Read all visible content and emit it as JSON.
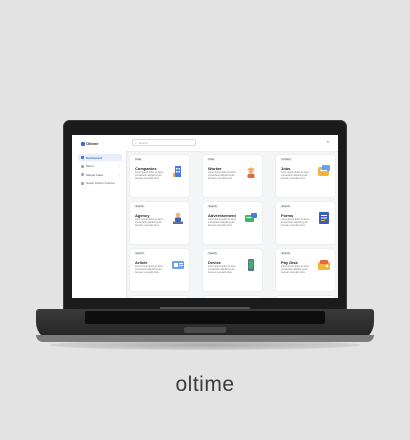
{
  "brand": "oltime",
  "app": {
    "logo_text": "Oltime",
    "search_placeholder": "Search",
    "close_symbol": "×"
  },
  "sidebar": {
    "items": [
      {
        "label": "Dashboard",
        "active": true
      },
      {
        "label": "Menu",
        "active": false
      },
      {
        "label": "Master Data",
        "active": false
      },
      {
        "label": "Super Admin Control",
        "active": false
      }
    ]
  },
  "cards": [
    {
      "tag": "Data",
      "title": "Companies",
      "desc": "Lorem ipsum dolor sit amet, consectetur adipiscing elit. Aenean venenatis risus",
      "icon": "building-icon"
    },
    {
      "tag": "Data",
      "title": "Worker",
      "desc": "Lorem ipsum dolor sit amet, consectetur adipiscing elit. Aenean venenatis risus",
      "icon": "worker-icon"
    },
    {
      "tag": "Content",
      "title": "Jobs",
      "desc": "Lorem ipsum dolor sit amet, consectetur adipiscing elit. Aenean venenatis risus",
      "icon": "jobs-icon"
    },
    {
      "tag": "Search",
      "title": "Agency",
      "desc": "Lorem ipsum dolor sit amet, consectetur adipiscing elit. Aenean venenatis risus",
      "icon": "agency-icon"
    },
    {
      "tag": "Search",
      "title": "Advertisement",
      "desc": "Lorem ipsum dolor sit amet, consectetur adipiscing elit. Aenean venenatis risus",
      "icon": "advertisement-icon"
    },
    {
      "tag": "Search",
      "title": "Forms",
      "desc": "Lorem ipsum dolor sit amet, consectetur adipiscing elit. Aenean venenatis risus",
      "icon": "forms-icon"
    },
    {
      "tag": "Search",
      "title": "Article",
      "desc": "Lorem ipsum dolor sit amet, consectetur adipiscing elit. Aenean venenatis risus",
      "icon": "article-icon"
    },
    {
      "tag": "Search",
      "title": "Device",
      "desc": "Lorem ipsum dolor sit amet, consectetur adipiscing elit. Aenean venenatis risus",
      "icon": "device-icon"
    },
    {
      "tag": "Search",
      "title": "Pay Disk",
      "desc": "Lorem ipsum dolor sit amet, consectetur adipiscing elit. Aenean venenatis risus",
      "icon": "pay-disk-icon"
    }
  ],
  "colors": {
    "accent": "#3f6fd8",
    "background": "#e3e3e3",
    "close": "#e05656"
  }
}
